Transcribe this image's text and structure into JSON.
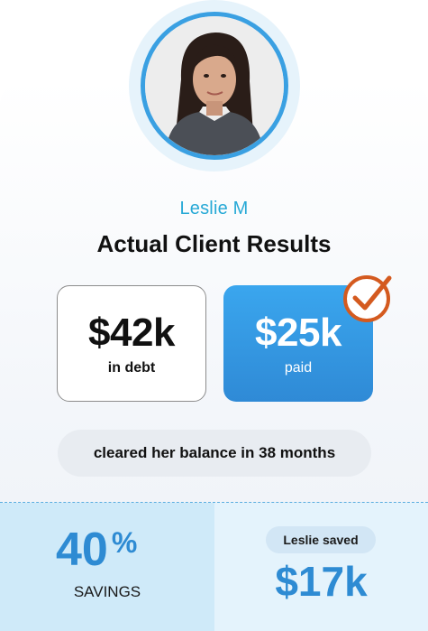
{
  "client": {
    "name": "Leslie M",
    "title": "Actual Client Results"
  },
  "stats": {
    "debt": {
      "value": "$42k",
      "label": "in debt"
    },
    "paid": {
      "value": "$25k",
      "label": "paid"
    }
  },
  "summary": "cleared her balance in 38 months",
  "savings": {
    "percent": "40",
    "percent_symbol": "%",
    "label": "SAVINGS"
  },
  "saved": {
    "label": "Leslie saved",
    "amount": "$17k"
  },
  "colors": {
    "accent_blue": "#2e8bd3",
    "name_teal": "#27a9d6",
    "check_orange": "#d45a1f"
  },
  "icons": {
    "badge": "checkmark-circle-icon",
    "avatar": "client-avatar"
  }
}
